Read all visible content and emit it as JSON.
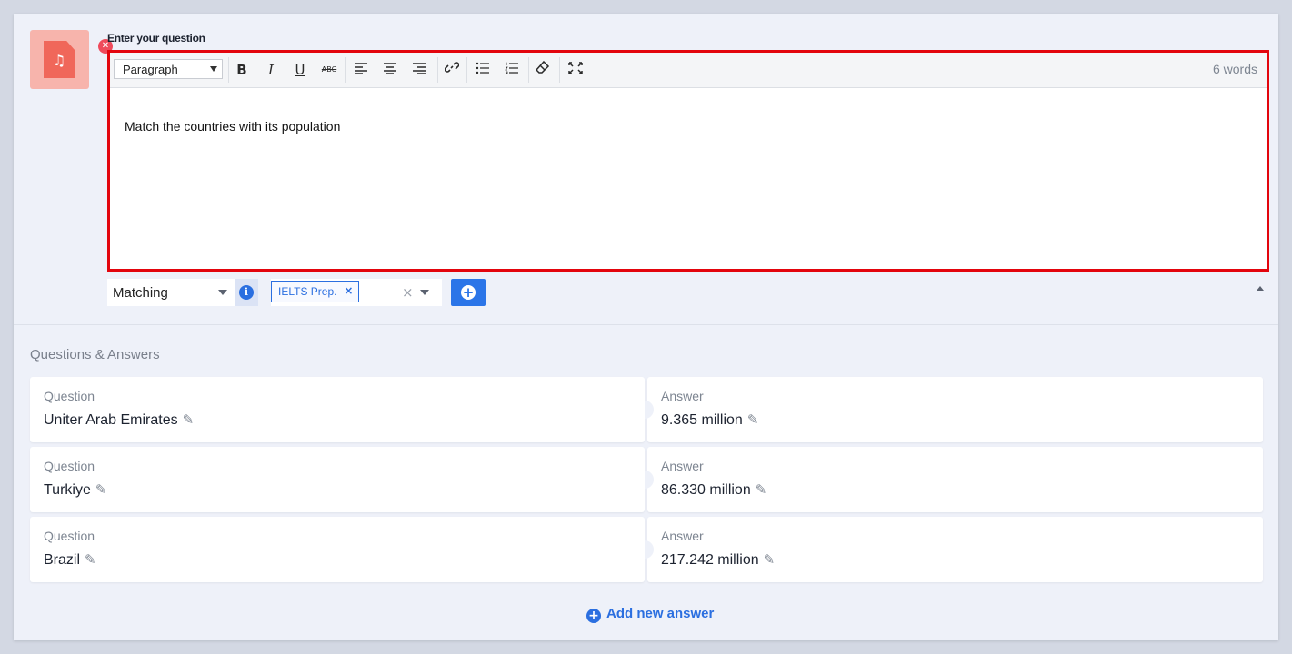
{
  "question_editor": {
    "label": "Enter your question",
    "file_icon": "music-file-icon",
    "remove_icon": "close-icon",
    "toolbar": {
      "block_format": "Paragraph",
      "buttons": [
        "bold-icon",
        "italic-icon",
        "underline-icon",
        "strikethrough-icon",
        "align-left-icon",
        "align-center-icon",
        "align-right-icon",
        "link-icon",
        "bullet-list-icon",
        "numbered-list-icon",
        "eraser-icon",
        "fullscreen-icon"
      ],
      "word_count": "6 words"
    },
    "content": "Match the countries with its population"
  },
  "controls": {
    "question_type": "Matching",
    "tag": "IELTS Prep.",
    "tag_remove": "×",
    "tag_clear": "×"
  },
  "qa": {
    "title": "Questions & Answers",
    "question_caption": "Question",
    "answer_caption": "Answer",
    "pairs": [
      {
        "question": "Uniter Arab Emirates",
        "answer": "9.365 million"
      },
      {
        "question": "Turkiye",
        "answer": "86.330 million"
      },
      {
        "question": "Brazil",
        "answer": "217.242 million"
      }
    ],
    "add_label": "Add new answer"
  },
  "colors": {
    "accent": "#2b6fe0",
    "highlight_border": "#e3050d",
    "file_icon_bg": "#f7b4ac",
    "remove_badge": "#ef4a5b"
  }
}
